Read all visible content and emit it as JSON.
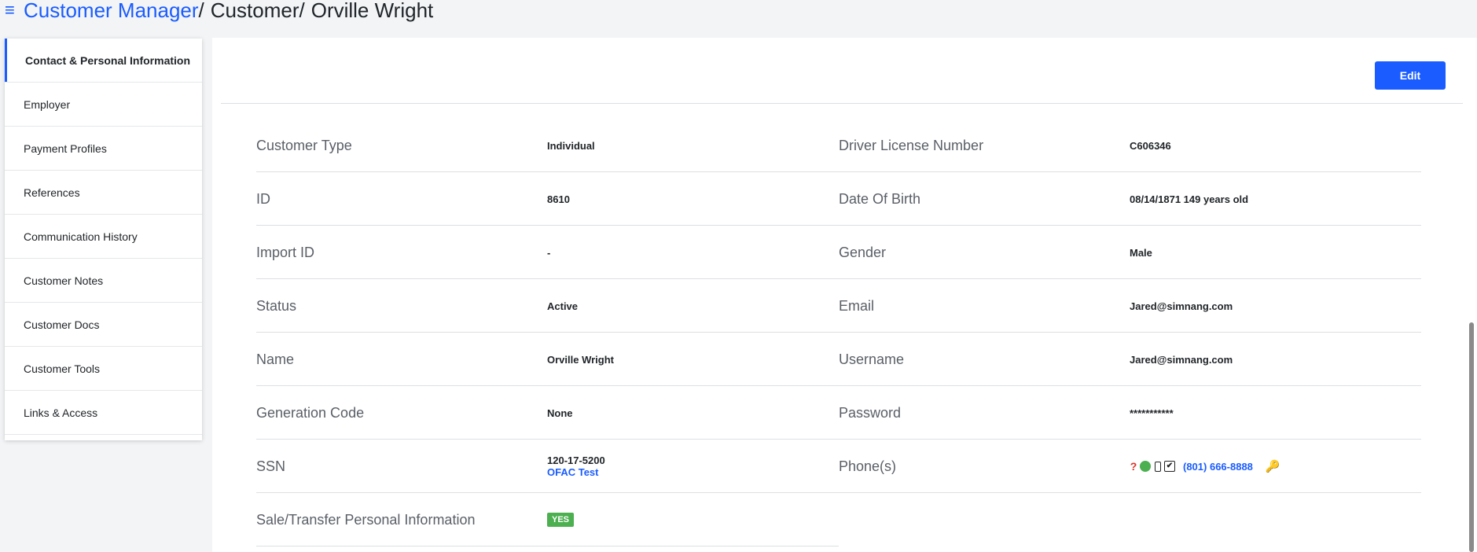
{
  "header": {
    "menu_icon": "≡",
    "app": "Customer Manager",
    "sep1": "/",
    "section": "Customer",
    "sep2": "/",
    "customer_name": "Orville Wright"
  },
  "sidebar": {
    "items": [
      {
        "label": "Contact & Personal Information",
        "active": true
      },
      {
        "label": "Employer"
      },
      {
        "label": "Payment Profiles"
      },
      {
        "label": "References"
      },
      {
        "label": "Communication History"
      },
      {
        "label": "Customer Notes"
      },
      {
        "label": "Customer Docs"
      },
      {
        "label": "Customer Tools"
      },
      {
        "label": "Links & Access"
      }
    ]
  },
  "main": {
    "edit_label": "Edit",
    "left_fields": [
      {
        "label": "Customer Type",
        "value": "Individual"
      },
      {
        "label": "ID",
        "value": "8610"
      },
      {
        "label": "Import ID",
        "value": "-"
      },
      {
        "label": "Status",
        "value": "Active"
      },
      {
        "label": "Name",
        "value": "Orville Wright"
      },
      {
        "label": "Generation Code",
        "value": "None"
      },
      {
        "label": "SSN",
        "value": "120-17-5200",
        "sub_link": "OFAC Test"
      },
      {
        "label": "Sale/Transfer Personal Information",
        "badge": "YES"
      }
    ],
    "right_fields": [
      {
        "label": "Driver License Number",
        "value": "C606346"
      },
      {
        "label": "Date Of Birth",
        "value": "08/14/1871 149 years old"
      },
      {
        "label": "Gender",
        "value": "Male"
      },
      {
        "label": "Email",
        "value": "Jared@simnang.com"
      },
      {
        "label": "Username",
        "value": "Jared@simnang.com"
      },
      {
        "label": "Password",
        "value": "***********"
      },
      {
        "label": "Phone(s)",
        "phone": "(801) 666-8888",
        "icons": {
          "question": "?",
          "check": "✔",
          "key": "🔑"
        }
      }
    ]
  },
  "colors": {
    "accent": "#1a5cff",
    "badge_green": "#4caf50",
    "status_red": "#d9342b",
    "key_gold": "#e6a817"
  }
}
